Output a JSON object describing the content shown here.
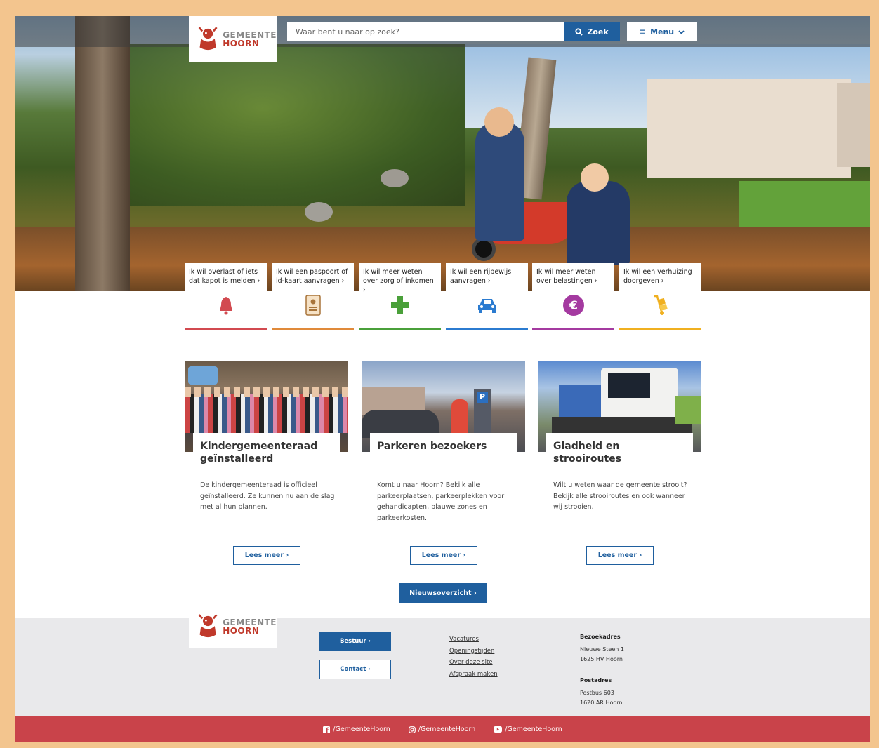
{
  "header": {
    "logo_line1": "GEMEENTE",
    "logo_line2": "HOORN",
    "search_placeholder": "Waar bent u naar op zoek?",
    "search_button": "Zoek",
    "menu_button": "Menu"
  },
  "tasks": [
    {
      "label": "Ik wil overlast of iets dat kapot is melden ›",
      "icon": "bell-icon",
      "color": "#d24a50"
    },
    {
      "label": "Ik wil een paspoort of id-kaart aanvragen ›",
      "icon": "id-card-icon",
      "color": "#e08a3a"
    },
    {
      "label": "Ik wil meer weten over zorg of inkomen ›",
      "icon": "plus-icon",
      "color": "#4aa03a"
    },
    {
      "label": "Ik wil een rijbewijs aanvragen ›",
      "icon": "car-icon",
      "color": "#2b7bd0"
    },
    {
      "label": "Ik wil meer weten over belastingen ›",
      "icon": "euro-icon",
      "color": "#a43aa0"
    },
    {
      "label": "Ik wil een verhuizing doorgeven ›",
      "icon": "hand-truck-icon",
      "color": "#f0b020"
    }
  ],
  "news": [
    {
      "title": "Kindergemeenteraad geïnstalleerd",
      "desc": "De kindergemeenteraad is officieel geïnstalleerd. Ze kunnen nu aan de slag met al hun plannen.",
      "button": "Lees meer ›"
    },
    {
      "title": "Parkeren bezoekers",
      "desc": "Komt u naar Hoorn? Bekijk alle parkeerplaatsen, parkeerplekken voor gehandicapten, blauwe zones en parkeerkosten.",
      "button": "Lees meer ›"
    },
    {
      "title": "Gladheid en strooiroutes",
      "desc": "Wilt u weten waar de gemeente strooit? Bekijk alle strooiroutes en ook wanneer wij strooien.",
      "button": "Lees meer ›"
    }
  ],
  "overview_button": "Nieuwsoverzicht ›",
  "footer": {
    "bestuur": "Bestuur ›",
    "contact": "Contact ›",
    "links": [
      "Vacatures",
      "Openingstijden",
      "Over deze site",
      "Afspraak maken"
    ],
    "visit_heading": "Bezoekadres",
    "visit_line1": "Nieuwe Steen 1",
    "visit_line2": "1625 HV Hoorn",
    "post_heading": "Postadres",
    "post_line1": "Postbus 603",
    "post_line2": "1620 AR Hoorn"
  },
  "social": {
    "facebook": "/GemeenteHoorn",
    "instagram": "/GemeenteHoorn",
    "youtube": "/GemeenteHoorn"
  }
}
